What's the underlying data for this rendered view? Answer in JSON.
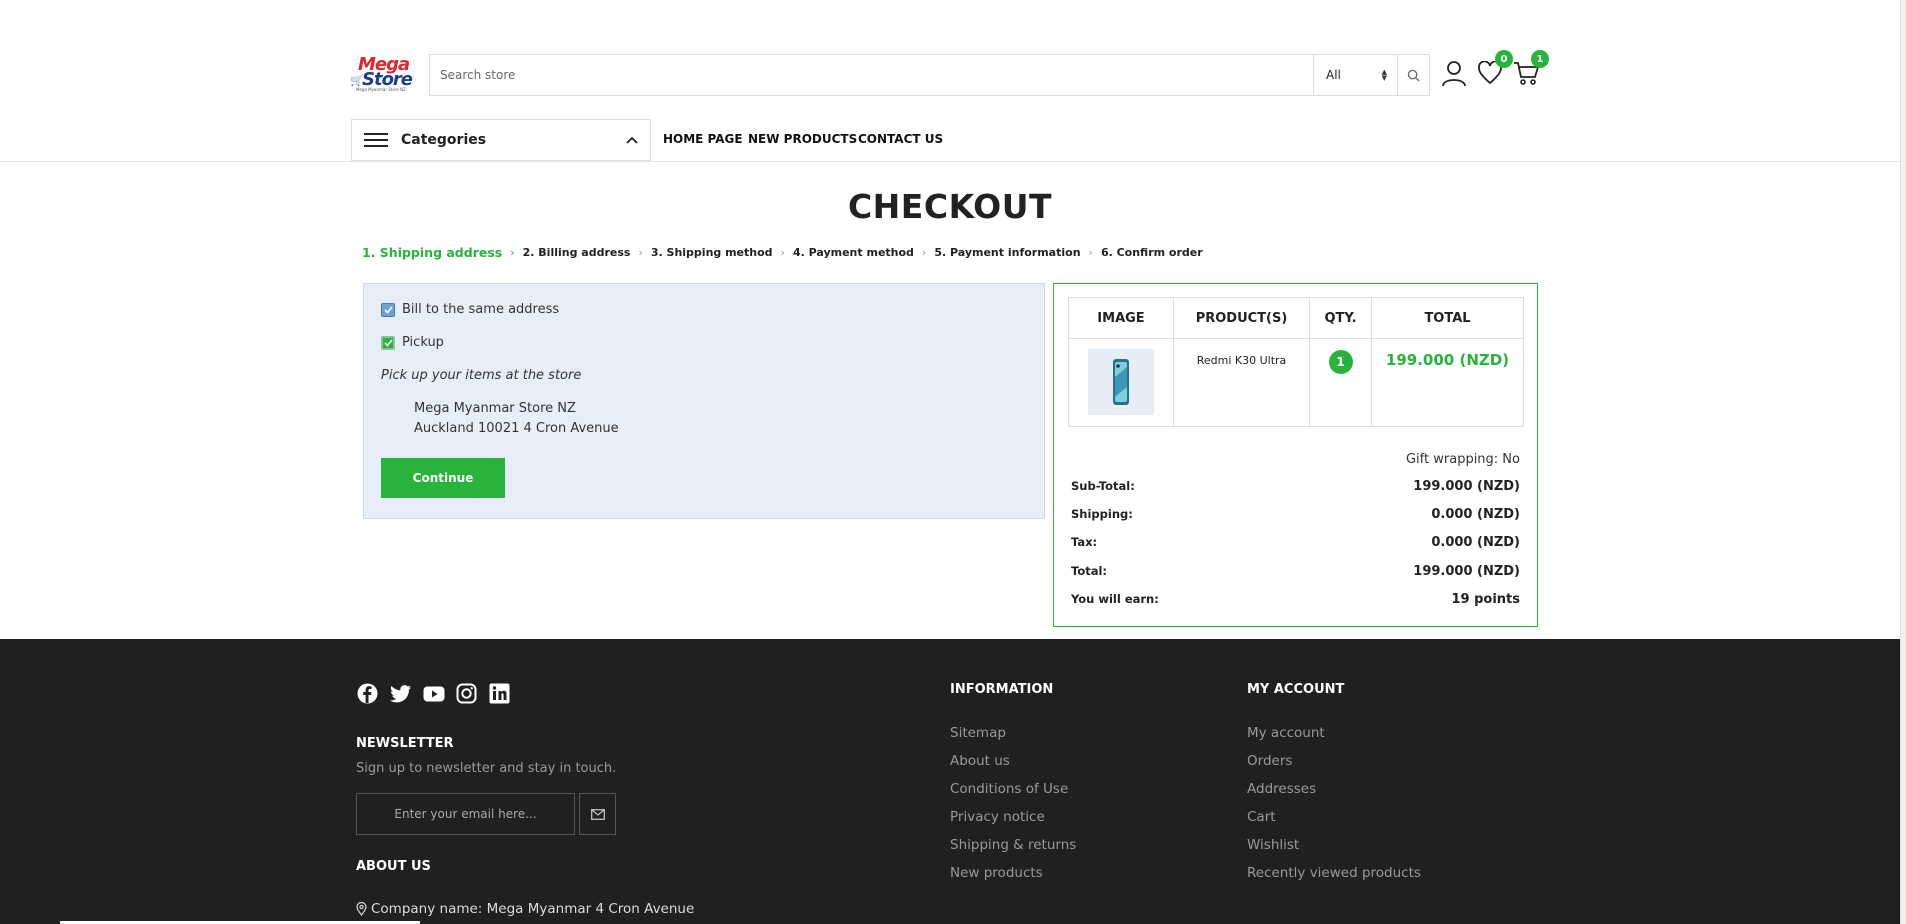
{
  "header": {
    "logo": {
      "line1": "Mega",
      "line2": "Store",
      "tagline": "Mega Myanmar Store NZ"
    },
    "search": {
      "placeholder": "Search store",
      "category_selected": "All"
    },
    "wishlist_count": "0",
    "cart_count": "1"
  },
  "nav": {
    "categories_label": "Categories",
    "links": [
      "HOME PAGE",
      "NEW PRODUCTS",
      "CONTACT US"
    ]
  },
  "checkout": {
    "title": "CHECKOUT",
    "steps": [
      "1. Shipping address",
      "2. Billing address",
      "3. Shipping method",
      "4. Payment method",
      "5. Payment information",
      "6. Confirm order"
    ],
    "bill_same_label": "Bill to the same address",
    "pickup_label": "Pickup",
    "pickup_note": "Pick up your items at the store",
    "store_name": "Mega Myanmar Store NZ",
    "store_address": "Auckland 10021 4 Cron Avenue",
    "continue_label": "Continue"
  },
  "summary": {
    "columns": [
      "IMAGE",
      "PRODUCT(S)",
      "QTY.",
      "TOTAL"
    ],
    "item": {
      "name": "Redmi K30 Ultra",
      "qty": "1",
      "total": "199.000 (NZD)"
    },
    "gift_wrapping": "Gift wrapping: No",
    "totals": [
      {
        "label": "Sub-Total:",
        "value": "199.000 (NZD)"
      },
      {
        "label": "Shipping:",
        "value": "0.000 (NZD)"
      },
      {
        "label": "Tax:",
        "value": "0.000 (NZD)"
      },
      {
        "label": "Total:",
        "value": "199.000 (NZD)"
      },
      {
        "label": "You will earn:",
        "value": "19 points"
      }
    ]
  },
  "footer": {
    "newsletter_title": "NEWSLETTER",
    "newsletter_text": "Sign up to newsletter and stay in touch.",
    "newsletter_placeholder": "Enter your email here...",
    "about_title": "ABOUT US",
    "company_line": "Company name: Mega Myanmar 4 Cron Avenue",
    "information_title": "INFORMATION",
    "information_links": [
      "Sitemap",
      "About us",
      "Conditions of Use",
      "Privacy notice",
      "Shipping & returns",
      "New products"
    ],
    "account_title": "MY ACCOUNT",
    "account_links": [
      "My account",
      "Orders",
      "Addresses",
      "Cart",
      "Wishlist",
      "Recently viewed products"
    ]
  },
  "colors": {
    "accent": "#28b43c",
    "footer_bg": "#211f1f",
    "panel_bg": "#e8eef8"
  },
  "icons": [
    "search-icon",
    "user-icon",
    "heart-icon",
    "cart-icon",
    "chevron-up-icon",
    "facebook-icon",
    "twitter-icon",
    "youtube-icon",
    "instagram-icon",
    "linkedin-icon",
    "mail-icon",
    "location-pin-icon"
  ]
}
